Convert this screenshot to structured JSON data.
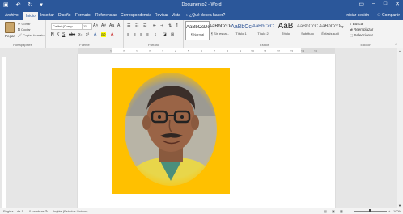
{
  "window": {
    "title": "Documento2 - Word"
  },
  "qat": {
    "save_icon": "save-icon",
    "undo_icon": "undo-icon",
    "redo_icon": "redo-icon",
    "customize_icon": "chevron-down-icon"
  },
  "tabs": [
    {
      "label": "Archivo"
    },
    {
      "label": "Inicio"
    },
    {
      "label": "Insertar"
    },
    {
      "label": "Diseño"
    },
    {
      "label": "Formato"
    },
    {
      "label": "Referencias"
    },
    {
      "label": "Correspondencia"
    },
    {
      "label": "Revisar"
    },
    {
      "label": "Vista"
    }
  ],
  "tellme": "¿Qué desea hacer?",
  "account": {
    "signin": "Iniciar sesión",
    "share": "Compartir"
  },
  "clipboard": {
    "paste": "Pegar",
    "cut": "Cortar",
    "copy": "Copiar",
    "format_painter": "Copiar formato",
    "group": "Portapapeles"
  },
  "font": {
    "name": "Calibri (Cuerp",
    "size": "11",
    "group": "Fuente"
  },
  "paragraph": {
    "group": "Párrafo"
  },
  "styles": {
    "group": "Estilos",
    "items": [
      {
        "sample": "AaBbCcDc",
        "name": "¶ Normal"
      },
      {
        "sample": "AaBbCcDc",
        "name": "¶ Sin espa..."
      },
      {
        "sample": "AaBbCc",
        "name": "Título 1"
      },
      {
        "sample": "AaBbCcC",
        "name": "Título 2"
      },
      {
        "sample": "AaB",
        "name": "Título"
      },
      {
        "sample": "AaBbCcC",
        "name": "Subtítulo"
      },
      {
        "sample": "AaBbCcDc",
        "name": "Énfasis sutil"
      }
    ]
  },
  "editing": {
    "find": "Buscar",
    "replace": "Reemplazar",
    "select": "Seleccionar",
    "group": "Edición"
  },
  "status": {
    "page": "Página 1 de 1",
    "words": "0 palabras",
    "lang": "Inglés (Estados Unidos)",
    "zoom": "100%"
  },
  "colors": {
    "accent": "#2b579a",
    "photo_bg": "#ffc000"
  }
}
